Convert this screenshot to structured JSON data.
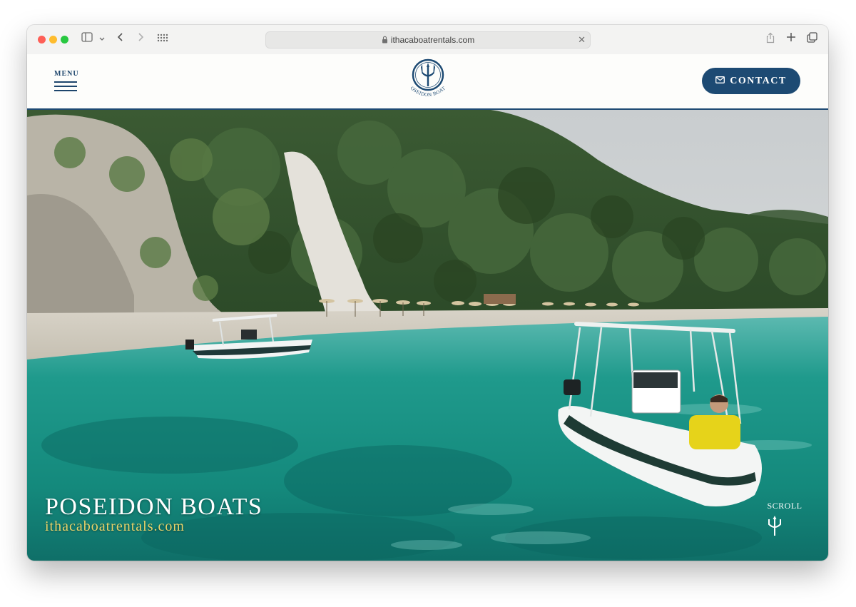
{
  "browser": {
    "url": "ithacaboatrentals.com",
    "icons": [
      "sidebar-icon",
      "chevron-down-icon",
      "back-icon",
      "forward-icon",
      "grid-icon",
      "lock-icon",
      "close-icon",
      "share-icon",
      "plus-icon",
      "tabs-icon"
    ]
  },
  "header": {
    "menu_label": "MENU",
    "logo_text": "POSEIDON BOATS",
    "contact_label": "CONTACT"
  },
  "hero": {
    "title": "POSEIDON BOATS",
    "subtitle": "ithacaboatrentals.com",
    "scroll_label": "SCROLL"
  },
  "colors": {
    "brand_navy": "#1d4a73",
    "accent_gold": "#e8d36a",
    "sea_turquoise": "#1f9a8c"
  }
}
